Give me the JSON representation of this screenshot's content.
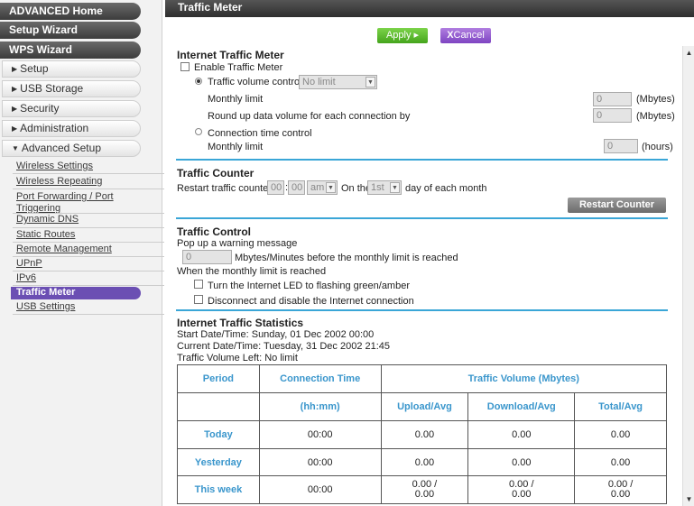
{
  "sidebar": {
    "top_buttons": [
      "ADVANCED Home",
      "Setup Wizard",
      "WPS Wizard"
    ],
    "sections": [
      "Setup",
      "USB Storage",
      "Security",
      "Administration",
      "Advanced Setup"
    ],
    "sub_items": [
      "Wireless Settings",
      "Wireless Repeating",
      "Port Forwarding / Port Triggering",
      "Dynamic DNS",
      "Static Routes",
      "Remote Management",
      "UPnP",
      "IPv6",
      "Traffic Meter",
      "USB Settings"
    ]
  },
  "header": {
    "title": "Traffic Meter"
  },
  "toolbar": {
    "apply_label": "Apply ▸",
    "cancel_x": "X",
    "cancel_label": "Cancel"
  },
  "meter": {
    "heading": "Internet Traffic Meter",
    "enable_label": "Enable Traffic Meter",
    "volume_control_label": "Traffic volume control by",
    "volume_control_value": "No limit",
    "monthly_limit_label": "Monthly limit",
    "monthly_limit_value": "0",
    "mbytes_unit": "(Mbytes)",
    "roundup_label": "Round up data volume for each connection by",
    "roundup_value": "0",
    "conn_time_label": "Connection time control",
    "monthly_limit2_label": "Monthly limit",
    "monthly_limit2_value": "0",
    "hours_unit": "(hours)"
  },
  "counter": {
    "heading": "Traffic Counter",
    "restart_label": "Restart traffic counter at",
    "hour": "00",
    "minute": "00",
    "ampm": "am",
    "on_the": "On the",
    "day": "1st",
    "day_suffix": "day of each month",
    "restart_button": "Restart Counter Now"
  },
  "control": {
    "heading": "Traffic Control",
    "popup_label": "Pop up a warning message",
    "popup_value": "0",
    "popup_suffix": "Mbytes/Minutes before the monthly limit is reached",
    "when_label": "When the monthly limit is reached",
    "led_label": "Turn the Internet LED to flashing green/amber",
    "disconnect_label": "Disconnect and disable the Internet connection"
  },
  "stats": {
    "heading": "Internet Traffic Statistics",
    "start": "Start Date/Time: Sunday, 01 Dec 2002 00:00",
    "current": "Current Date/Time: Tuesday, 31 Dec 2002 21:45",
    "volume_left": "Traffic Volume Left: No limit",
    "col_period": "Period",
    "col_conn_time": "Connection Time",
    "col_conn_unit": "(hh:mm)",
    "col_volume": "Traffic Volume (Mbytes)",
    "col_upload": "Upload/Avg",
    "col_download": "Download/Avg",
    "col_total": "Total/Avg",
    "rows": [
      {
        "period": "Today",
        "time": "00:00",
        "upload": "0.00",
        "download": "0.00",
        "total": "0.00"
      },
      {
        "period": "Yesterday",
        "time": "00:00",
        "upload": "0.00",
        "download": "0.00",
        "total": "0.00"
      },
      {
        "period": "This week",
        "time": "00:00",
        "upload": "0.00 /\n0.00",
        "download": "0.00 /\n0.00",
        "total": "0.00 /\n0.00"
      }
    ]
  },
  "colors": {
    "accent": "#3aa6d7",
    "apply": "#5bbd2b",
    "cancel": "#8e55cc",
    "active_nav": "#6b4fb3"
  }
}
